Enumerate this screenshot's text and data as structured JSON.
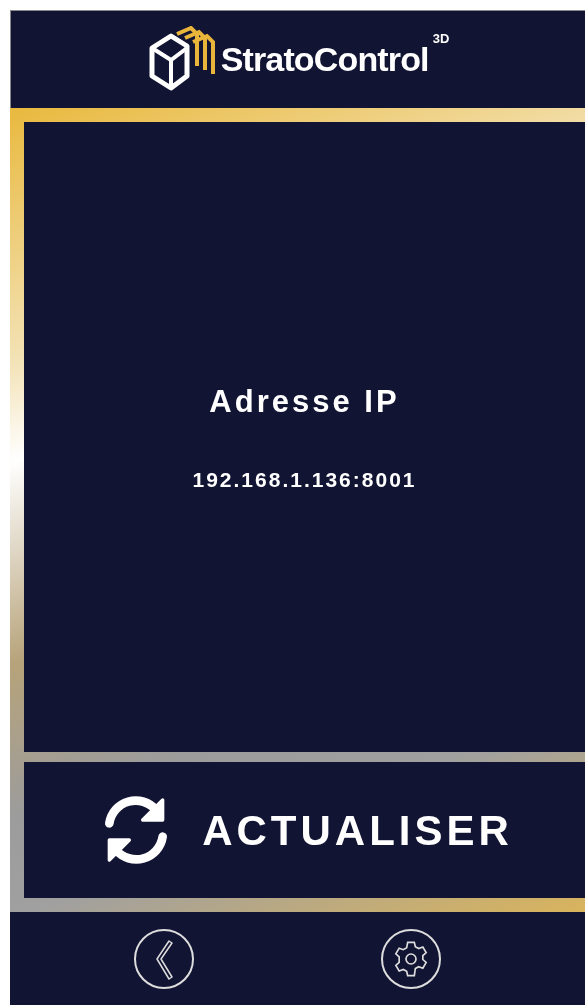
{
  "header": {
    "brand": "StratoControl",
    "brand_superscript": "3D"
  },
  "info": {
    "title": "Adresse IP",
    "value": "192.168.1.136:8001"
  },
  "refresh_button": {
    "label": "ACTUALISER"
  },
  "footer": {
    "buttons": [
      {
        "kind": "back"
      },
      {
        "kind": "settings"
      }
    ]
  }
}
